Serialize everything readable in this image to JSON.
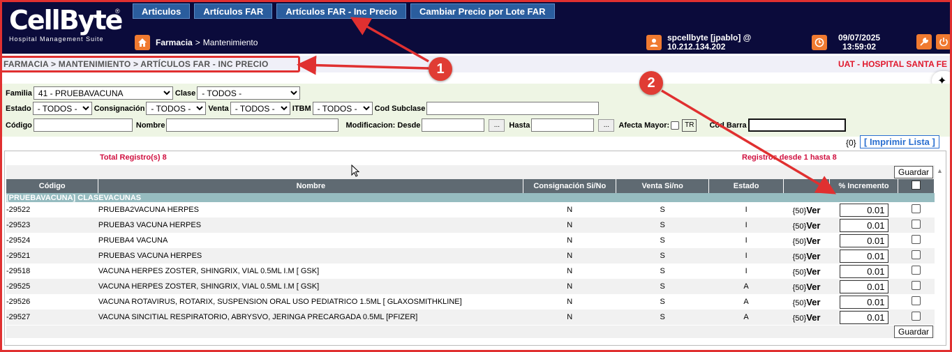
{
  "app": {
    "logo_text": "CellByte",
    "logo_reg": "®",
    "logo_subtitle": "Hospital Management Suite"
  },
  "topnav": [
    "Articulos",
    "Artículos FAR",
    "Artículos FAR - Inc Precio",
    "Cambiar Precio por Lote FAR"
  ],
  "top_crumb": {
    "section": "Farmacia",
    "sep": ">",
    "page": "Mantenimiento"
  },
  "user": {
    "line1": "spcellbyte [jpablo] @",
    "line2": "10.212.134.202"
  },
  "datetime": {
    "date": "09/07/2025",
    "time": "13:59:02"
  },
  "breadcrumb": "FARMACIA > MANTENIMIENTO > ARTÍCULOS FAR - INC PRECIO",
  "environment": "UAT - HOSPITAL SANTA FE",
  "filters": {
    "familia_label": "Familia",
    "familia_value": "41 - PRUEBAVACUNA",
    "clase_label": "Clase",
    "clase_value": "- TODOS -",
    "estado_label": "Estado",
    "estado_value": "- TODOS -",
    "consignacion_label": "Consignación",
    "consignacion_value": "- TODOS -",
    "venta_label": "Venta",
    "venta_value": "- TODOS -",
    "itbm_label": "ITBM",
    "itbm_value": "- TODOS -",
    "subclase_label": "Cod Subclase",
    "codigo_label": "Código",
    "nombre_label": "Nombre",
    "desde_label": "Modificacion: Desde",
    "hasta_label": "Hasta",
    "dots": "...",
    "afecta_label": "Afecta Mayor:",
    "tr_label": "TR",
    "barra_label": "Cód Barra"
  },
  "list_actions": {
    "count": "{0}",
    "print": "[ Imprimir Lista ]"
  },
  "summary": {
    "total": "Total Registro(s) 8",
    "range": "Registros desde 1 hasta 8"
  },
  "save_label": "Guardar",
  "columns": [
    "Código",
    "Nombre",
    "Consignación Si/No",
    "Venta Si/no",
    "Estado",
    "",
    "% Incremento"
  ],
  "group_label": "[PRUEBAVACUNA] CLASEVACUNAS",
  "rows": [
    {
      "code": "-29522",
      "name": "PRUEBA2VACUNA HERPES",
      "consig": "N",
      "venta": "S",
      "estado": "I",
      "count": "{50}",
      "ver": "Ver",
      "pct": "0.01"
    },
    {
      "code": "-29523",
      "name": "PRUEBA3 VACUNA HERPES",
      "consig": "N",
      "venta": "S",
      "estado": "I",
      "count": "{50}",
      "ver": "Ver",
      "pct": "0.01"
    },
    {
      "code": "-29524",
      "name": "PRUEBA4 VACUNA",
      "consig": "N",
      "venta": "S",
      "estado": "I",
      "count": "{50}",
      "ver": "Ver",
      "pct": "0.01"
    },
    {
      "code": "-29521",
      "name": "PRUEBAS VACUNA HERPES",
      "consig": "N",
      "venta": "S",
      "estado": "I",
      "count": "{50}",
      "ver": "Ver",
      "pct": "0.01"
    },
    {
      "code": "-29518",
      "name": "VACUNA HERPES ZOSTER, SHINGRIX, VIAL 0.5ML I.M [ GSK]",
      "consig": "N",
      "venta": "S",
      "estado": "I",
      "count": "{50}",
      "ver": "Ver",
      "pct": "0.01"
    },
    {
      "code": "-29525",
      "name": "VACUNA HERPES ZOSTER, SHINGRIX, VIAL 0.5ML I.M [ GSK]",
      "consig": "N",
      "venta": "S",
      "estado": "A",
      "count": "{50}",
      "ver": "Ver",
      "pct": "0.01"
    },
    {
      "code": "-29526",
      "name": "VACUNA ROTAVIRUS, ROTARIX, SUSPENSION ORAL USO PEDIATRICO 1.5ML [ GLAXOSMITHKLINE]",
      "consig": "N",
      "venta": "S",
      "estado": "A",
      "count": "{50}",
      "ver": "Ver",
      "pct": "0.01"
    },
    {
      "code": "-29527",
      "name": "VACUNA SINCITIAL RESPIRATORIO, ABRYSVO, JERINGA PRECARGADA 0.5ML [PFIZER]",
      "consig": "N",
      "venta": "S",
      "estado": "A",
      "count": "{50}",
      "ver": "Ver",
      "pct": "0.01"
    }
  ],
  "annotations": {
    "badge1": "1",
    "badge2": "2"
  },
  "colors": {
    "header_bg": "#0b0b3b",
    "tab_bg": "#2a5d9e",
    "accent_red": "#e03030",
    "orange_icon": "#f07a30"
  }
}
